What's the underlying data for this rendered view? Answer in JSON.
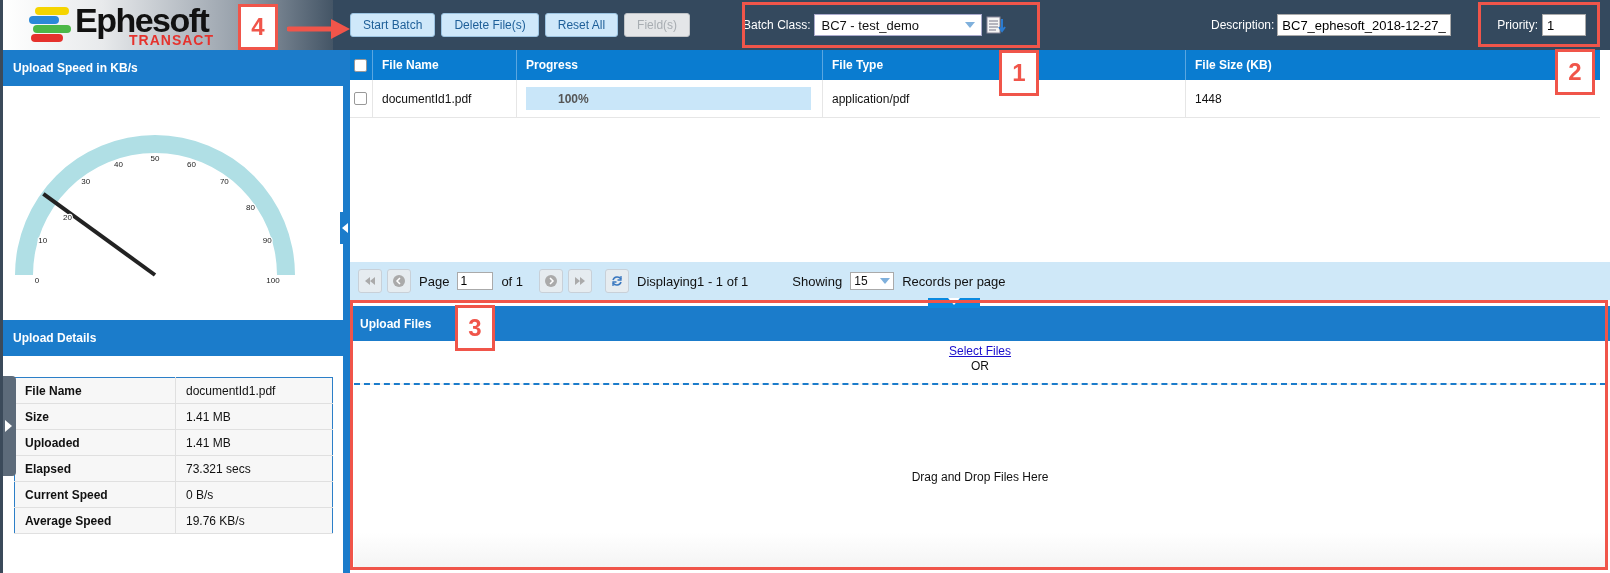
{
  "header": {
    "logo": {
      "name": "Ephesoft",
      "sub": "TRANSACT"
    },
    "buttons": [
      {
        "label": "Start Batch",
        "disabled": false
      },
      {
        "label": "Delete File(s)",
        "disabled": false
      },
      {
        "label": "Reset All",
        "disabled": false
      },
      {
        "label": "Field(s)",
        "disabled": true
      }
    ],
    "batch_class": {
      "label": "Batch Class:",
      "value": "BC7 - test_demo"
    },
    "description": {
      "label": "Description:",
      "value": "BC7_ephesoft_2018-12-27_"
    },
    "priority": {
      "label": "Priority:",
      "value": "1"
    }
  },
  "speed_panel": {
    "title": "Upload Speed in KB/s",
    "gauge": {
      "level": 0.2,
      "ticks": [
        "0",
        "10",
        "20",
        "30",
        "40",
        "50",
        "60",
        "70",
        "80",
        "90",
        "100"
      ]
    }
  },
  "details_panel": {
    "title": "Upload Details",
    "rows": [
      {
        "label": "File Name",
        "value": "documentId1.pdf"
      },
      {
        "label": "Size",
        "value": "1.41 MB"
      },
      {
        "label": "Uploaded",
        "value": "1.41 MB"
      },
      {
        "label": "Elapsed",
        "value": "73.321 secs"
      },
      {
        "label": "Current Speed",
        "value": "0 B/s"
      },
      {
        "label": "Average Speed",
        "value": "19.76 KB/s"
      }
    ]
  },
  "file_table": {
    "select_all": {
      "checked": false
    },
    "columns": [
      "File Name",
      "Progress",
      "File Type",
      "File Size (KB)"
    ],
    "rows": [
      {
        "checked": false,
        "file_name": "documentId1.pdf",
        "progress": {
          "level": 1,
          "reading": "100%"
        },
        "file_type": "application/pdf",
        "file_size": "1448"
      }
    ]
  },
  "pager": {
    "page_label": "Page",
    "page": "1",
    "of": "of 1",
    "displaying": "Displaying1 - 1 of 1",
    "showing": "Showing",
    "per_page": "15",
    "records": "Records per page"
  },
  "upload": {
    "title": "Upload Files",
    "link": "Select Files",
    "or": "OR",
    "drop": "Drag and Drop Files Here"
  },
  "callouts": [
    {
      "label": "1"
    },
    {
      "label": "2"
    },
    {
      "label": "3"
    },
    {
      "label": "4"
    }
  ]
}
